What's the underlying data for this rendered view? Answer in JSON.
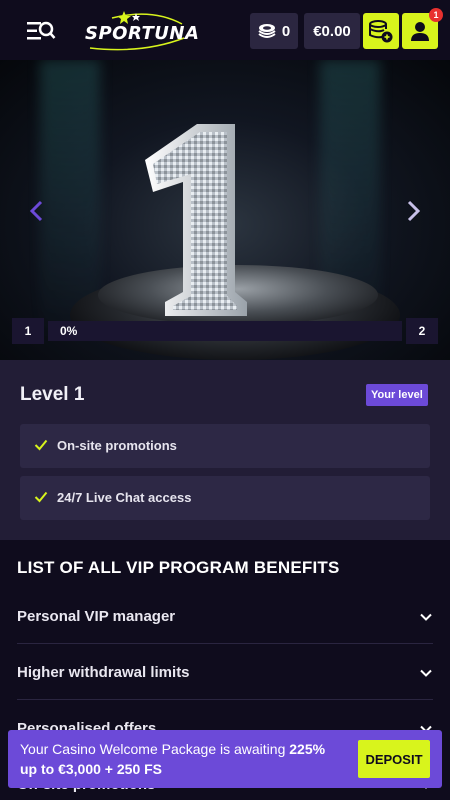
{
  "header": {
    "logo_text": "SPORTUNA",
    "coins_count": "0",
    "balance": "€0.00",
    "notification_count": "1"
  },
  "hero": {
    "level_start": "1",
    "level_end": "2",
    "progress_label": "0%",
    "progress_value": 0
  },
  "level_card": {
    "title": "Level 1",
    "badge": "Your level",
    "benefits": [
      "On-site promotions",
      "24/7 Live Chat access"
    ]
  },
  "vip": {
    "title": "LIST OF ALL VIP PROGRAM BENEFITS",
    "items": [
      "Personal VIP manager",
      "Higher withdrawal limits",
      "Personalised offers",
      "On-site promotions"
    ]
  },
  "promo": {
    "text_prefix": "Your Casino Welcome Package is awaiting ",
    "text_bold_1": "225%",
    "text_bold_2": "up to €3,000 + 250 FS",
    "button": "DEPOSIT"
  },
  "colors": {
    "background": "#0f0c1d",
    "accent_lime": "#d8f41c",
    "accent_purple": "#6c4ad8",
    "card": "#221d36"
  }
}
